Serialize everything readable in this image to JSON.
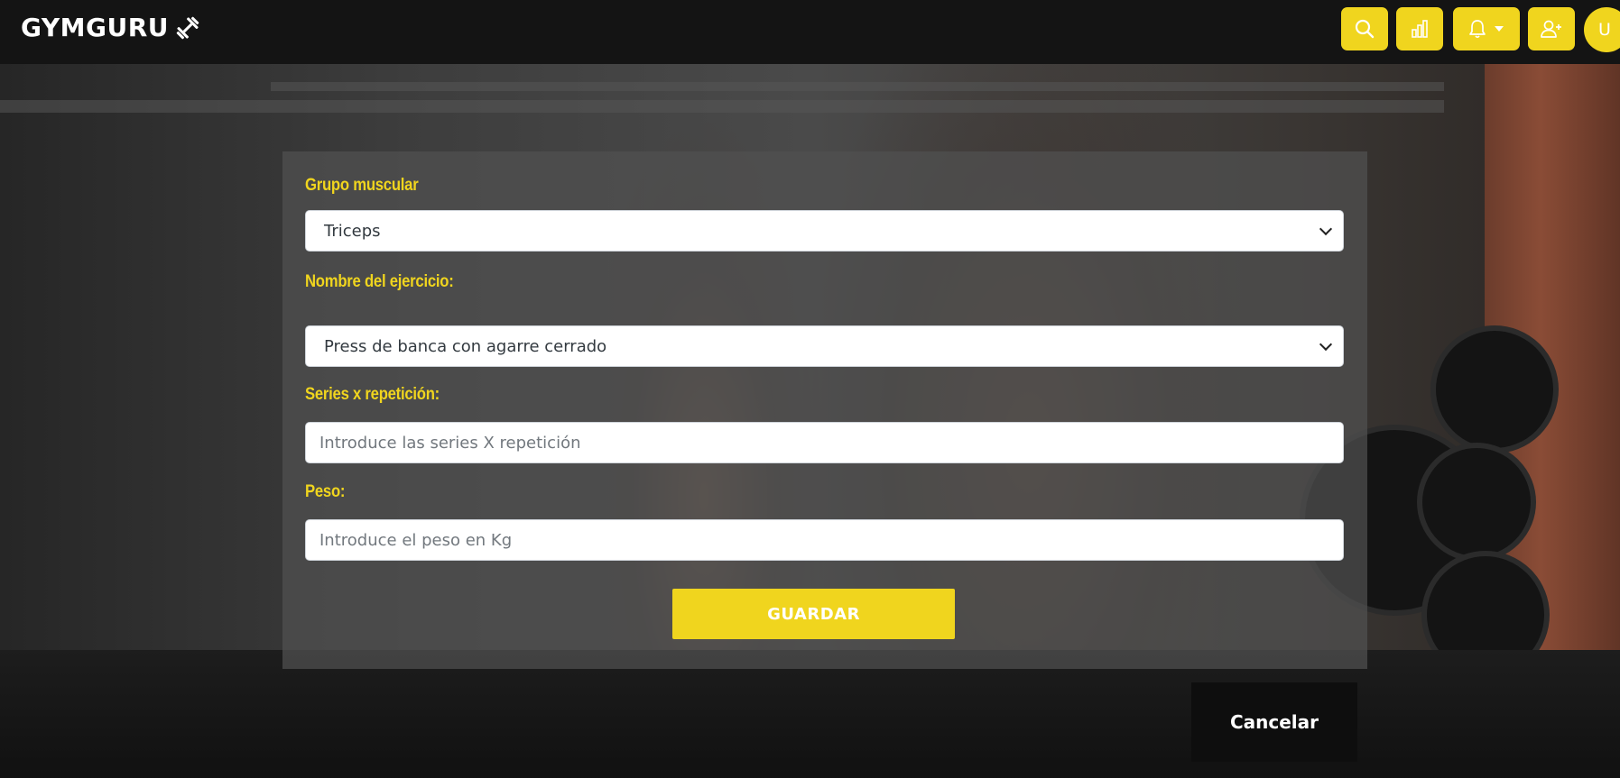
{
  "navbar": {
    "brand": "GYMGURU",
    "brand_icon": "dumbbell-icon",
    "buttons": [
      {
        "icon": "search-icon"
      },
      {
        "icon": "bar-chart-icon"
      },
      {
        "icon": "bell-dropdown-icon"
      },
      {
        "icon": "add-user-icon"
      }
    ],
    "avatar_initial": "U",
    "accent_color": "#f0d51e"
  },
  "form": {
    "muscle_group": {
      "label": "Grupo muscular",
      "value": "Triceps"
    },
    "exercise_name": {
      "label": "Nombre del ejercicio:",
      "value": "Press de banca con agarre cerrado"
    },
    "series": {
      "label": "Series x repetición:",
      "placeholder": "Introduce las series X repetición"
    },
    "weight": {
      "label": "Peso:",
      "placeholder": "Introduce el peso en Kg"
    },
    "save_label": "GUARDAR"
  },
  "cancel_label": "Cancelar"
}
